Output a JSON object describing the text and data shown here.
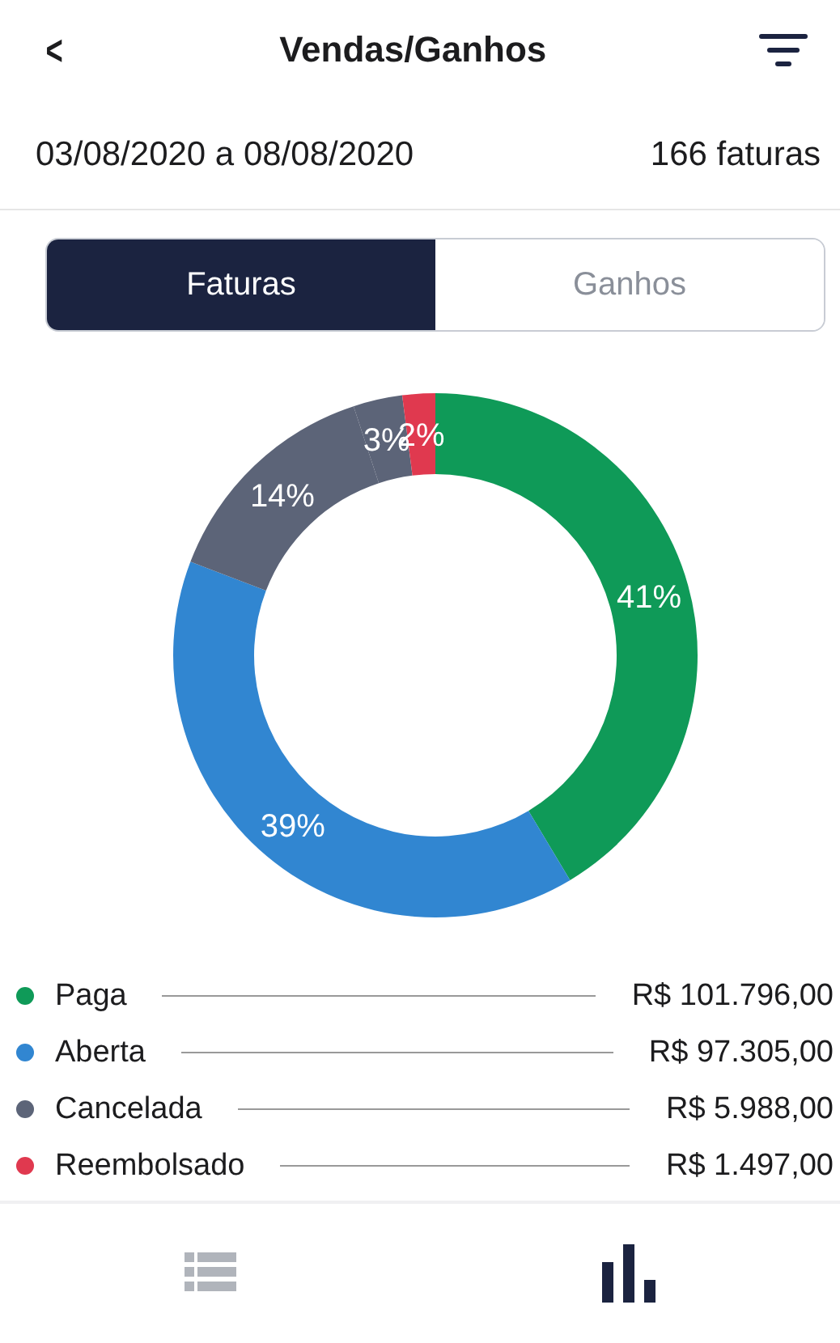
{
  "header": {
    "back": "<",
    "title": "Vendas/Ganhos"
  },
  "summary": {
    "period": "03/08/2020 a 08/08/2020",
    "count": "166 faturas"
  },
  "tabs": [
    {
      "label": "Faturas",
      "selected": true
    },
    {
      "label": "Ganhos",
      "selected": false
    }
  ],
  "chart_data": {
    "type": "donut",
    "values": [
      41,
      39,
      14,
      3,
      2
    ],
    "value_labels": [
      "41%",
      "39%",
      "14%",
      "3%",
      "2%"
    ],
    "colors": [
      "#0f9a58",
      "#3186d1",
      "#5c6478",
      "#5c6478",
      "#e0394f"
    ]
  },
  "legend": [
    {
      "label": "Paga",
      "value": "R$ 101.796,00",
      "color": "#0f9a58"
    },
    {
      "label": "Aberta",
      "value": "R$ 97.305,00",
      "color": "#3186d1"
    },
    {
      "label": "Cancelada",
      "value": "R$ 5.988,00",
      "color": "#5c6478"
    },
    {
      "label": "Reembolsado",
      "value": "R$ 1.497,00",
      "color": "#e0394f"
    }
  ],
  "bottom_nav": [
    {
      "kind": "list",
      "selected": false
    },
    {
      "kind": "chart",
      "selected": true
    }
  ]
}
